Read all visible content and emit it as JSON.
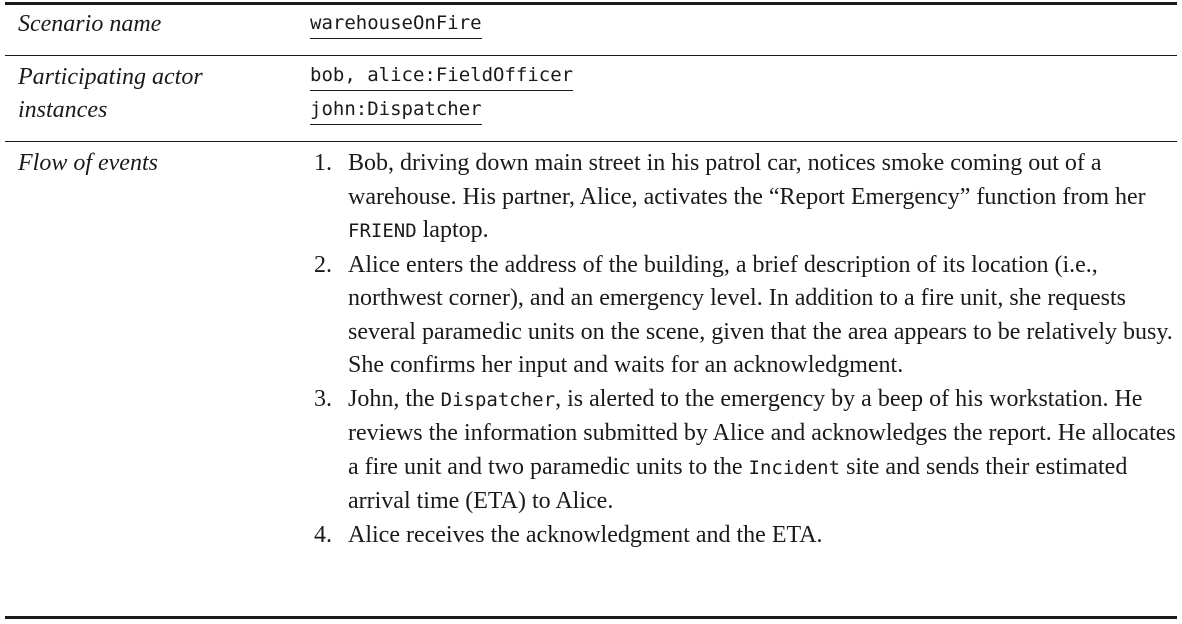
{
  "rows": {
    "scenario": {
      "label": "Scenario name",
      "value": "warehouseOnFire"
    },
    "actors": {
      "label_line1": "Participating actor",
      "label_line2": "instances",
      "value_line1": "bob, alice:FieldOfficer",
      "value_line2": "john:Dispatcher"
    },
    "flow": {
      "label": "Flow of events",
      "steps": [
        {
          "number": "1.",
          "t1": "Bob, driving down main street in his patrol car, notices smoke coming out of a warehouse. His partner, Alice, activates the “Report Emergency” function from her ",
          "code1": "FRIEND",
          "t2": " laptop."
        },
        {
          "number": "2.",
          "t1": "Alice enters the address of the building, a brief description of its location (i.e., northwest corner), and an emergency level. In addition to a fire unit, she requests several paramedic units on the scene, given that the area appears to be relatively busy. She confirms her input and waits for an acknowledgment."
        },
        {
          "number": "3.",
          "t1": "John, the ",
          "code1": "Dispatcher",
          "t2": ", is alerted to the emergency by a beep of his workstation. He reviews the information submitted by Alice and acknowledges the report. He allocates a fire unit and two paramedic units to the ",
          "code2": "Incident",
          "t3": " site and sends their estimated arrival time (ETA) to Alice."
        },
        {
          "number": "4.",
          "t1": "Alice receives the acknowledgment and the ETA."
        }
      ]
    }
  }
}
